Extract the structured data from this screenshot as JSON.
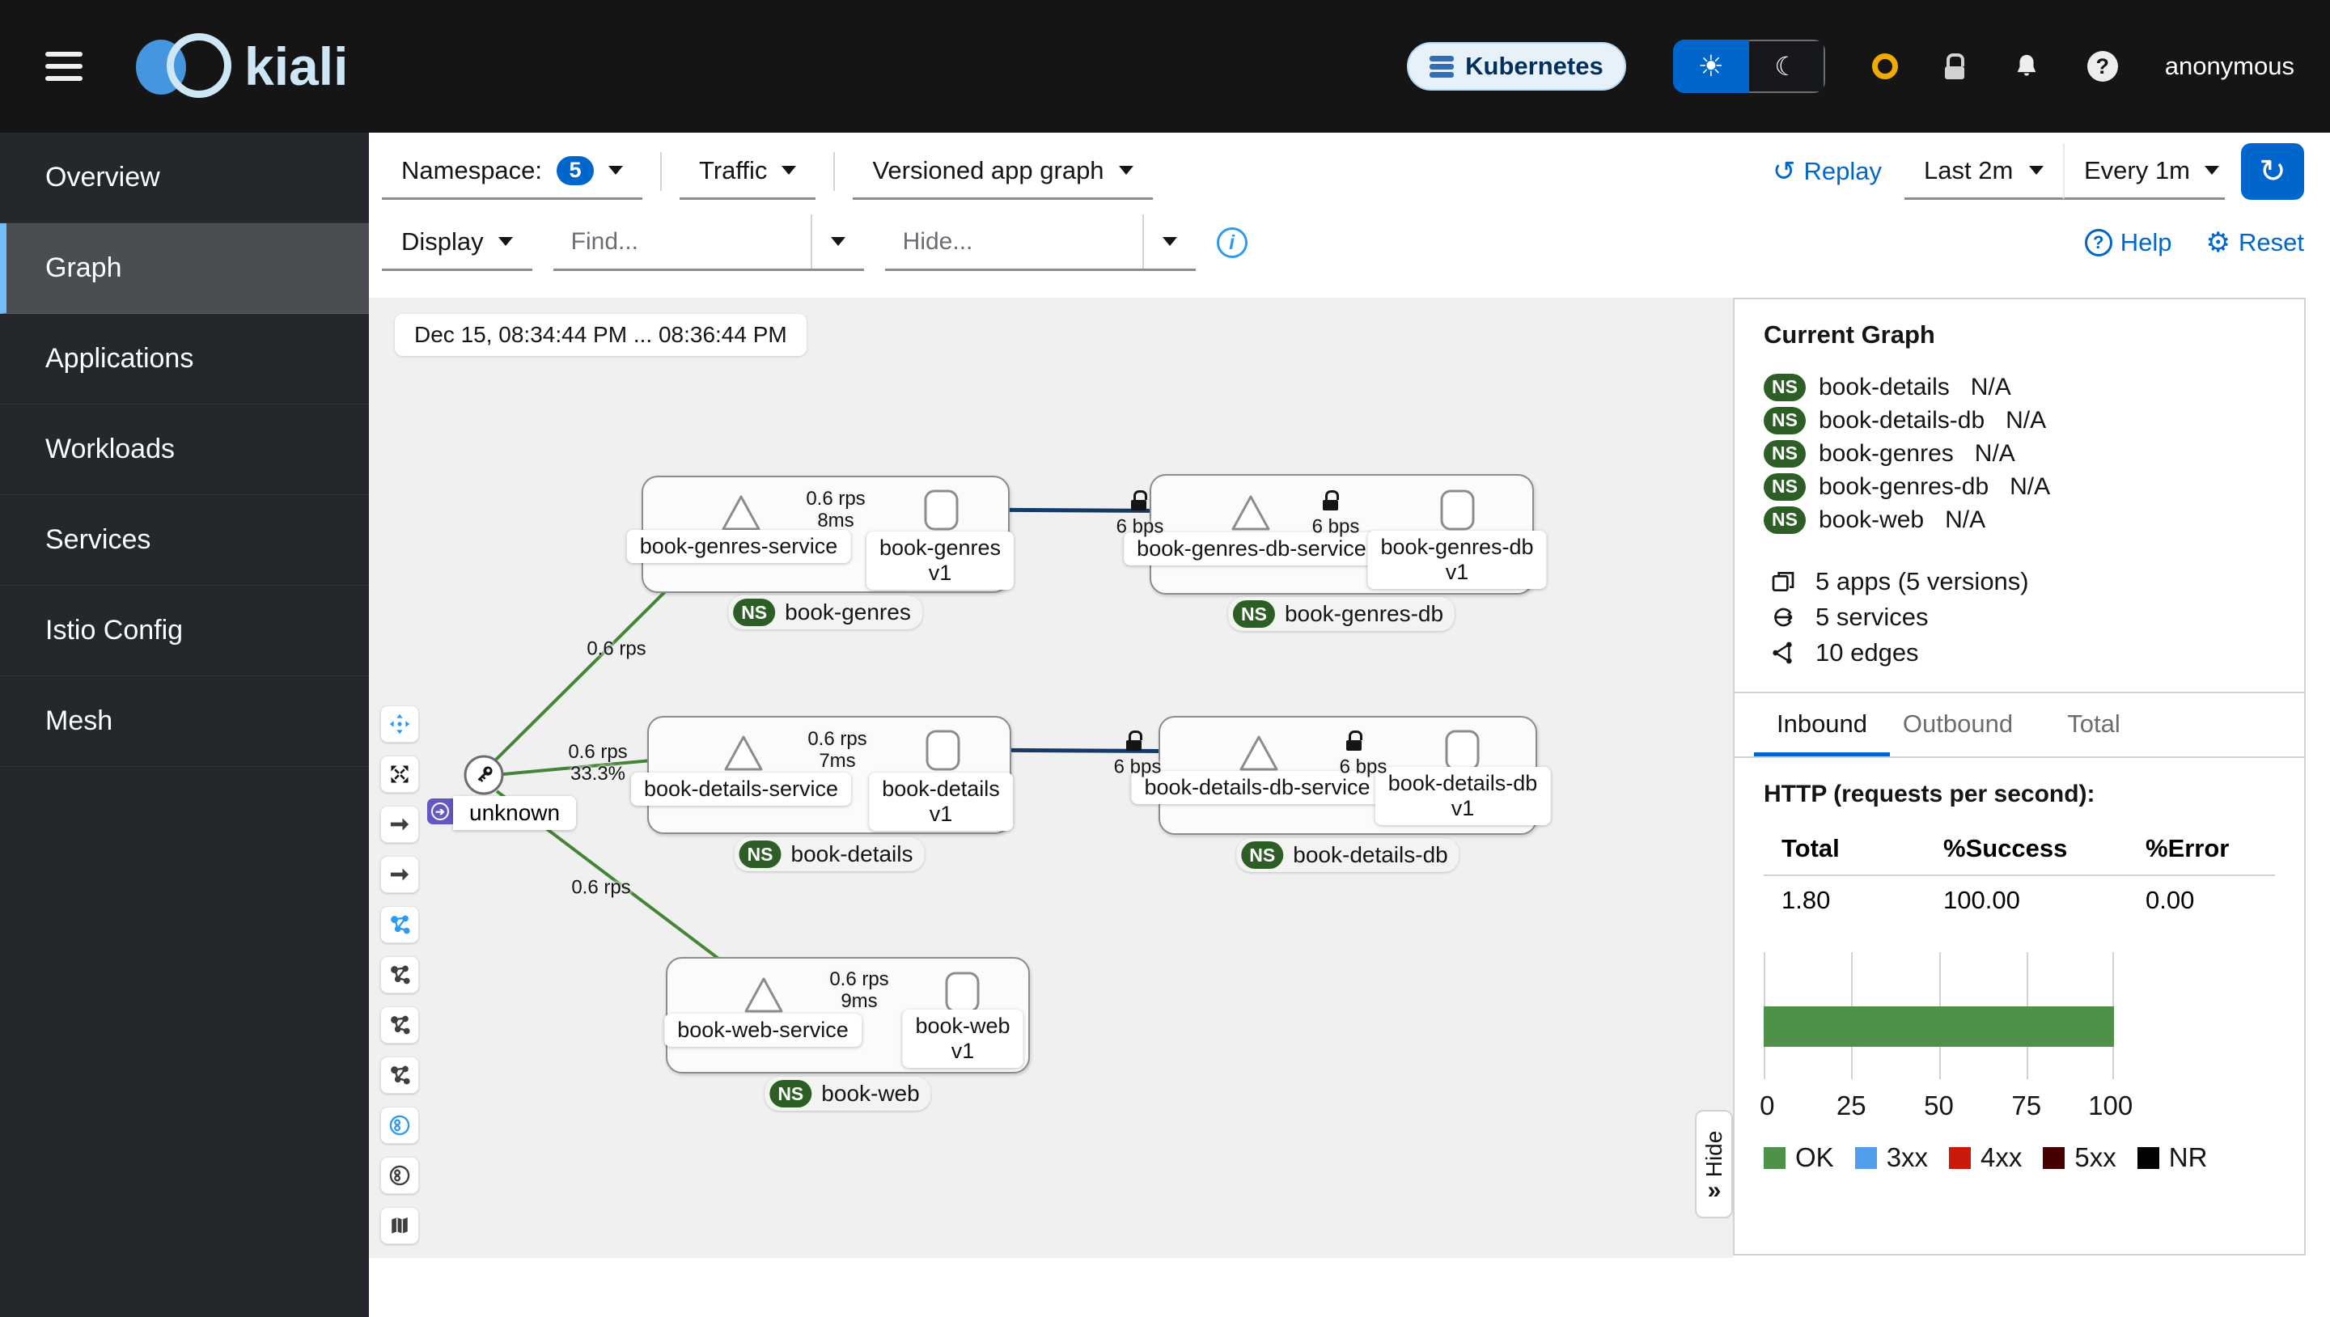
{
  "masthead": {
    "brand": "kiali",
    "cluster": "Kubernetes",
    "user": "anonymous"
  },
  "icons": {
    "sun": "☀",
    "moon": "☾",
    "replay": "↺",
    "refresh": "↻",
    "reset": "⚙",
    "help": "?",
    "question": "?",
    "info": "i",
    "chevrons": "»",
    "arrow_right": "➔"
  },
  "sidebar": {
    "items": [
      {
        "label": "Overview"
      },
      {
        "label": "Graph"
      },
      {
        "label": "Applications"
      },
      {
        "label": "Workloads"
      },
      {
        "label": "Services"
      },
      {
        "label": "Istio Config"
      },
      {
        "label": "Mesh"
      }
    ]
  },
  "toolbar": {
    "namespace_label": "Namespace:",
    "namespace_count": "5",
    "traffic": "Traffic",
    "graph_type": "Versioned app graph",
    "replay": "Replay",
    "duration": "Last 2m",
    "interval": "Every 1m",
    "display": "Display",
    "find_placeholder": "Find...",
    "hide_placeholder": "Hide...",
    "help": "Help",
    "reset": "Reset"
  },
  "graph": {
    "timestamp": "Dec 15, 08:34:44 PM ... 08:36:44 PM",
    "ns_badge": "NS",
    "unknown_label": "unknown",
    "groups": [
      {
        "namespace": "book-genres",
        "service": "book-genres-service",
        "workload": "book-genres",
        "version": "v1"
      },
      {
        "namespace": "book-genres-db",
        "service": "book-genres-db-service",
        "workload": "book-genres-db",
        "version": "v1"
      },
      {
        "namespace": "book-details",
        "service": "book-details-service",
        "workload": "book-details",
        "version": "v1"
      },
      {
        "namespace": "book-details-db",
        "service": "book-details-db-service",
        "workload": "book-details-db",
        "version": "v1"
      },
      {
        "namespace": "book-web",
        "service": "book-web-service",
        "workload": "book-web",
        "version": "v1"
      }
    ],
    "edges": [
      {
        "l1": "0.6 rps"
      },
      {
        "l1": "0.6 rps",
        "l2": "33.3%"
      },
      {
        "l1": "0.6 rps"
      },
      {
        "l1": "0.6 rps",
        "l2": "8ms"
      },
      {
        "l1": "6 bps"
      },
      {
        "l1": "6 bps"
      },
      {
        "l1": "0.6 rps",
        "l2": "7ms"
      },
      {
        "l1": "6 bps"
      },
      {
        "l1": "6 bps"
      },
      {
        "l1": "0.6 rps",
        "l2": "9ms"
      }
    ]
  },
  "panel": {
    "title": "Current Graph",
    "ns_badge": "NS",
    "namespaces": [
      {
        "name": "book-details",
        "status": "N/A"
      },
      {
        "name": "book-details-db",
        "status": "N/A"
      },
      {
        "name": "book-genres",
        "status": "N/A"
      },
      {
        "name": "book-genres-db",
        "status": "N/A"
      },
      {
        "name": "book-web",
        "status": "N/A"
      }
    ],
    "summary": [
      {
        "label": "5 apps (5 versions)"
      },
      {
        "label": "5 services"
      },
      {
        "label": "10 edges"
      }
    ],
    "tabs": [
      {
        "label": "Inbound"
      },
      {
        "label": "Outbound"
      },
      {
        "label": "Total"
      }
    ],
    "http_title": "HTTP (requests per second):",
    "table": {
      "headers": [
        "Total",
        "%Success",
        "%Error"
      ],
      "row": [
        "1.80",
        "100.00",
        "0.00"
      ]
    },
    "hide": "Hide"
  },
  "chart_data": {
    "type": "bar",
    "orientation": "horizontal",
    "title": "HTTP traffic status distribution (%)",
    "categories": [
      ""
    ],
    "series": [
      {
        "name": "OK",
        "values": [
          100
        ]
      },
      {
        "name": "3xx",
        "values": [
          0
        ]
      },
      {
        "name": "4xx",
        "values": [
          0
        ]
      },
      {
        "name": "5xx",
        "values": [
          0
        ]
      },
      {
        "name": "NR",
        "values": [
          0
        ]
      }
    ],
    "xlim": [
      0,
      100
    ],
    "x_ticks": [
      "0",
      "25",
      "50",
      "75",
      "100"
    ],
    "legend": [
      "OK",
      "3xx",
      "4xx",
      "5xx",
      "NR"
    ],
    "colors": {
      "OK": "#509149",
      "3xx": "#519de9",
      "4xx": "#c9190b",
      "5xx": "#470000",
      "NR": "#030303"
    },
    "grid": true,
    "legend_position": "bottom"
  }
}
